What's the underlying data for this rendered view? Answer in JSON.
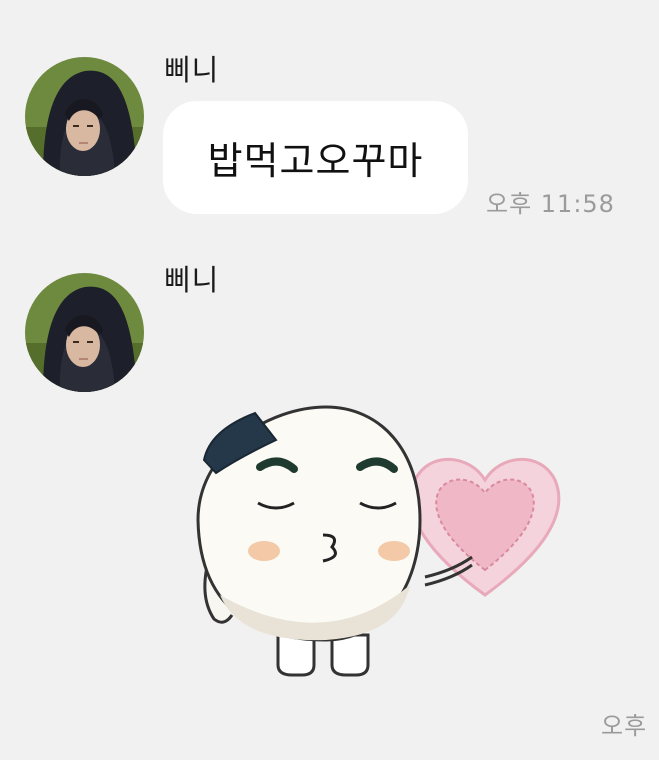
{
  "messages": [
    {
      "sender": "삐니",
      "avatar_icon": "profile-photo",
      "type": "text",
      "text": "밥먹고오꾸마",
      "time": "오후 11:58"
    },
    {
      "sender": "삐니",
      "avatar_icon": "profile-photo",
      "type": "sticker",
      "sticker_icon": "rice-ball-kiss-heart-sticker",
      "time": "오후"
    }
  ],
  "colors": {
    "background": "#f1f1f1",
    "bubble": "#ffffff",
    "timestamp": "#9b9b9b",
    "sticker_heart": "#f4c3cf",
    "sticker_seaweed": "#24384a"
  }
}
